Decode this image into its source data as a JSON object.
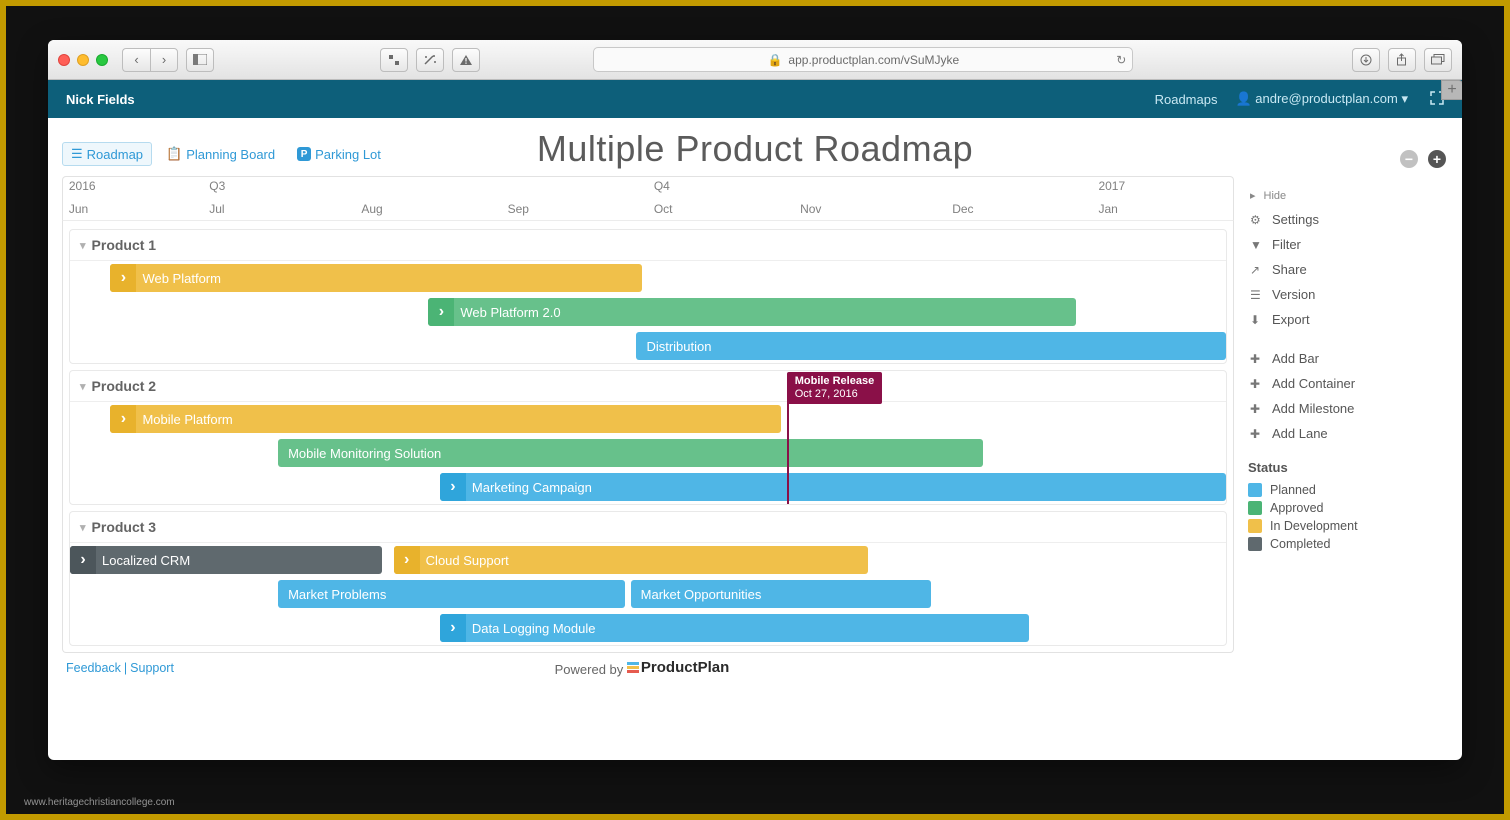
{
  "credit": "www.heritagechristiancollege.com",
  "browser": {
    "url": "app.productplan.com/vSuMJyke"
  },
  "app_bar": {
    "owner": "Nick Fields",
    "roadmaps_link": "Roadmaps",
    "user_email": "andre@productplan.com"
  },
  "page_title": "Multiple Product Roadmap",
  "view_tabs": {
    "roadmap": "Roadmap",
    "planning": "Planning Board",
    "parking": "Parking Lot"
  },
  "hide_label": "Hide",
  "timeline": {
    "years": [
      {
        "label": "2016",
        "left_pct": 0.5
      },
      {
        "label": "Q3",
        "left_pct": 12.5
      },
      {
        "label": "Q4",
        "left_pct": 50.5
      },
      {
        "label": "2017",
        "left_pct": 88.5
      }
    ],
    "months": [
      {
        "label": "Jun",
        "left_pct": 0.5
      },
      {
        "label": "Jul",
        "left_pct": 12.5
      },
      {
        "label": "Aug",
        "left_pct": 25.5
      },
      {
        "label": "Sep",
        "left_pct": 38.0
      },
      {
        "label": "Oct",
        "left_pct": 50.5
      },
      {
        "label": "Nov",
        "left_pct": 63.0
      },
      {
        "label": "Dec",
        "left_pct": 76.0
      },
      {
        "label": "Jan",
        "left_pct": 88.5
      }
    ]
  },
  "lanes": [
    {
      "title": "Product 1",
      "rows": [
        [
          {
            "label": "Web Platform",
            "color": "yellow",
            "handle": true,
            "left_pct": 3.5,
            "width_pct": 46
          }
        ],
        [
          {
            "label": "Web Platform 2.0",
            "color": "green",
            "handle": true,
            "left_pct": 31,
            "width_pct": 56
          }
        ],
        [
          {
            "label": "Distribution",
            "color": "blue",
            "handle": false,
            "left_pct": 49,
            "width_pct": 51
          }
        ]
      ]
    },
    {
      "title": "Product 2",
      "milestone": {
        "title": "Mobile Release",
        "date": "Oct 27, 2016",
        "left_pct": 62
      },
      "rows": [
        [
          {
            "label": "Mobile Platform",
            "color": "yellow",
            "handle": true,
            "left_pct": 3.5,
            "width_pct": 58
          }
        ],
        [
          {
            "label": "Mobile Monitoring Solution",
            "color": "green",
            "handle": false,
            "left_pct": 18,
            "width_pct": 61
          }
        ],
        [
          {
            "label": "Marketing Campaign",
            "color": "blue",
            "handle": true,
            "left_pct": 32,
            "width_pct": 68
          }
        ]
      ]
    },
    {
      "title": "Product 3",
      "rows": [
        [
          {
            "label": "Localized CRM",
            "color": "grey",
            "handle": true,
            "left_pct": 0,
            "width_pct": 27
          },
          {
            "label": "Cloud Support",
            "color": "yellow",
            "handle": true,
            "left_pct": 28,
            "width_pct": 41
          }
        ],
        [
          {
            "label": "Market Problems",
            "color": "blue",
            "handle": false,
            "left_pct": 18,
            "width_pct": 30
          },
          {
            "label": "Market Opportunities",
            "color": "blue",
            "handle": false,
            "left_pct": 48.5,
            "width_pct": 26
          }
        ],
        [
          {
            "label": "Data Logging Module",
            "color": "blue",
            "handle": true,
            "left_pct": 32,
            "width_pct": 51
          }
        ]
      ]
    }
  ],
  "side": {
    "settings": "Settings",
    "filter": "Filter",
    "share": "Share",
    "version": "Version",
    "export": "Export",
    "add_bar": "Add Bar",
    "add_container": "Add Container",
    "add_milestone": "Add Milestone",
    "add_lane": "Add Lane"
  },
  "status": {
    "title": "Status",
    "items": [
      {
        "label": "Planned",
        "color": "#4fb6e6"
      },
      {
        "label": "Approved",
        "color": "#4bb475"
      },
      {
        "label": "In Development",
        "color": "#f0c04a"
      },
      {
        "label": "Completed",
        "color": "#5f696e"
      }
    ]
  },
  "footer": {
    "feedback": "Feedback",
    "support": "Support",
    "powered_by": "Powered by",
    "brand": "ProductPlan"
  }
}
